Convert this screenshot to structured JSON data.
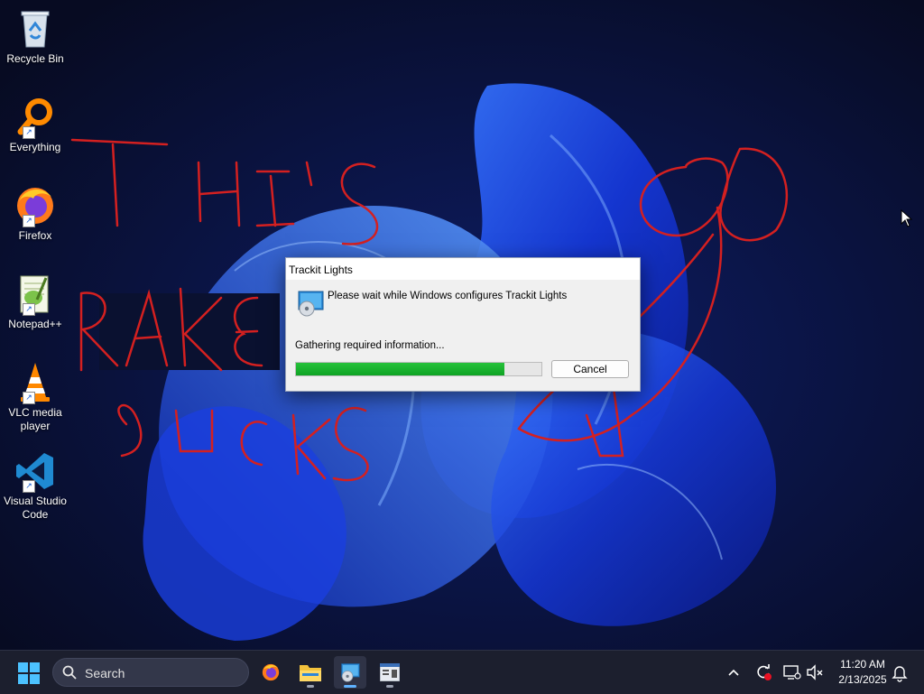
{
  "desktop": {
    "icons": [
      {
        "label": "Recycle Bin",
        "icon": "recycle-bin-icon"
      },
      {
        "label": "Everything",
        "icon": "everything-search-icon"
      },
      {
        "label": "Firefox",
        "icon": "firefox-icon"
      },
      {
        "label": "Notepad++",
        "icon": "notepad-plus-plus-icon"
      },
      {
        "label": "VLC media player",
        "icon": "vlc-cone-icon"
      },
      {
        "label": "Visual Studio Code",
        "icon": "vscode-icon"
      }
    ]
  },
  "dialog": {
    "title": "Trackit Lights",
    "message": "Please wait while Windows configures Trackit Lights",
    "status": "Gathering required information...",
    "progress": 0.85,
    "cancel_label": "Cancel",
    "icon": "installer-disc-icon"
  },
  "taskbar": {
    "search_label": "Search",
    "apps": [
      {
        "name": "Firefox",
        "icon": "firefox-icon"
      },
      {
        "name": "File Explorer",
        "icon": "folder-icon"
      },
      {
        "name": "Windows Installer",
        "icon": "installer-icon"
      },
      {
        "name": "Application window",
        "icon": "app-window-icon"
      }
    ],
    "tray": {
      "icons": [
        "chevron-up-icon",
        "update-icon",
        "network-icon",
        "volume-muted-icon",
        "notification-bell-icon"
      ]
    },
    "clock": {
      "time": "11:20 AM",
      "date": "2/13/2025"
    }
  },
  "colors": {
    "wallpaper_bloom": "#1e4ae0",
    "annotation_ink": "#d42020",
    "progress_fill": "#19b52d",
    "taskbar_bg": "#1c1f2e"
  }
}
